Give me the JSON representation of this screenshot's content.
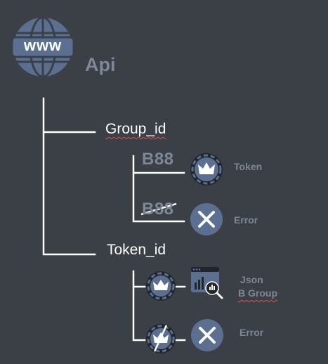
{
  "root": {
    "title": "Api",
    "globe_text": "www"
  },
  "nodes": {
    "group": {
      "label": "Group_id",
      "children": [
        {
          "badge": "B88",
          "icon": "crown-icon",
          "result": "Token"
        },
        {
          "badge": "B88",
          "struck": true,
          "icon": "close-icon",
          "result": "Error"
        }
      ]
    },
    "token": {
      "label": "Token_id",
      "children": [
        {
          "icon": "crown-icon",
          "result_icon": "json-chart-icon",
          "result_line1": "Json",
          "result_line2": "B Group"
        },
        {
          "icon": "crown-icon",
          "struck": true,
          "result_icon": "close-icon",
          "result": "Error"
        }
      ]
    }
  },
  "colors": {
    "background": "#3b3f46",
    "line": "#ffffff",
    "muted_text": "#7d8796",
    "icon_fill": "#5b6f91",
    "icon_ring": "#22262b"
  }
}
